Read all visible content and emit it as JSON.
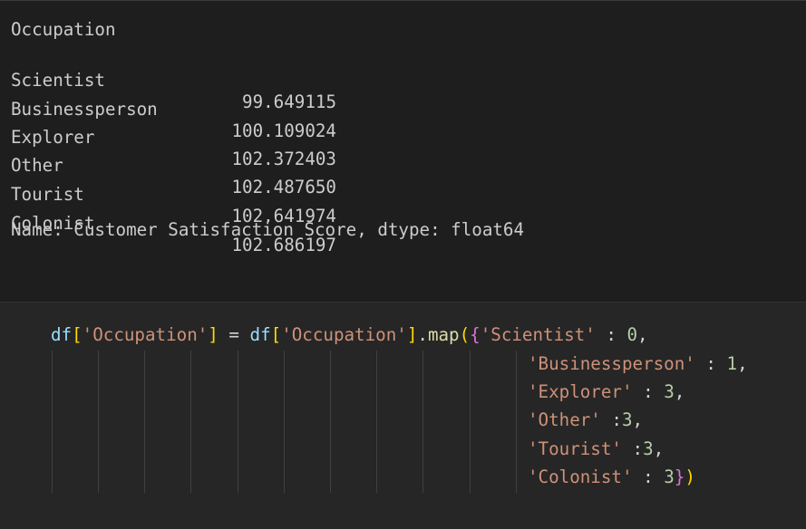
{
  "output": {
    "header": "Occupation",
    "rows": [
      {
        "label": "Scientist",
        "value": "99.649115"
      },
      {
        "label": "Businessperson",
        "value": "100.109024"
      },
      {
        "label": "Explorer",
        "value": "102.372403"
      },
      {
        "label": "Other",
        "value": "102.487650"
      },
      {
        "label": "Tourist",
        "value": "102.641974"
      },
      {
        "label": "Colonist",
        "value": "102.686197"
      }
    ],
    "footer": "Name: Customer Satisfaction Score, dtype: float64"
  },
  "code": {
    "var": "df",
    "col": "'Occupation'",
    "eq": " = ",
    "method": "map",
    "entries": [
      {
        "key": "'Scientist'",
        "sep": " : ",
        "val": "0",
        "end": ","
      },
      {
        "key": "'Businessperson'",
        "sep": " : ",
        "val": "1",
        "end": ","
      },
      {
        "key": "'Explorer'",
        "sep": " : ",
        "val": "3",
        "end": ","
      },
      {
        "key": "'Other'",
        "sep": " :",
        "val": "3",
        "end": ","
      },
      {
        "key": "'Tourist'",
        "sep": " :",
        "val": "3",
        "end": ","
      },
      {
        "key": "'Colonist'",
        "sep": " : ",
        "val": "3",
        "end": ""
      }
    ],
    "colors": {
      "variable": "#9cdcfe",
      "function": "#dcdcaa",
      "string": "#ce9178",
      "number": "#b5cea8",
      "bracket_level1": "#ffd700",
      "bracket_level2": "#da70d6",
      "bracket_level3": "#179fff"
    }
  }
}
